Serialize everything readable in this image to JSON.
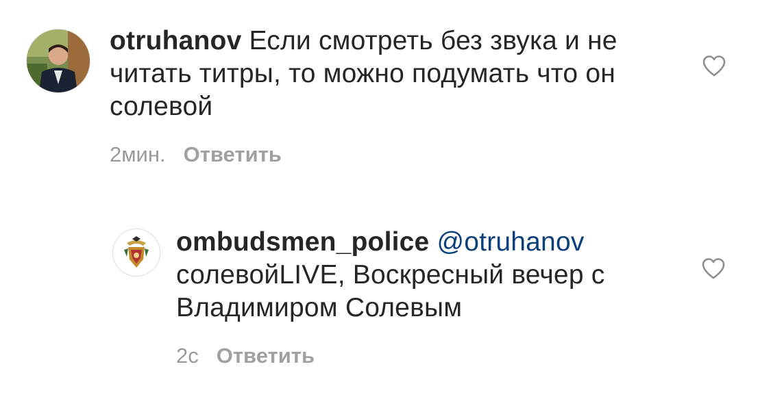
{
  "comments": [
    {
      "username": "otruhanov",
      "text": " Если смотреть без звука и не читать титры, то можно подумать что он солевой",
      "time": "2мин.",
      "reply_label": "Ответить",
      "avatar_icon": "user-photo-avatar",
      "like_icon": "heart-outline-icon"
    },
    {
      "username": "ombudsmen_police",
      "mention": "@otruhanov",
      "text": " солевойLIVE, Воскресный вечер с Владимиром Солевым",
      "time": "2с",
      "reply_label": "Ответить",
      "avatar_icon": "police-emblem-avatar",
      "like_icon": "heart-outline-icon"
    }
  ],
  "colors": {
    "text": "#262626",
    "meta": "#999999",
    "mention": "#0b3f7c"
  }
}
